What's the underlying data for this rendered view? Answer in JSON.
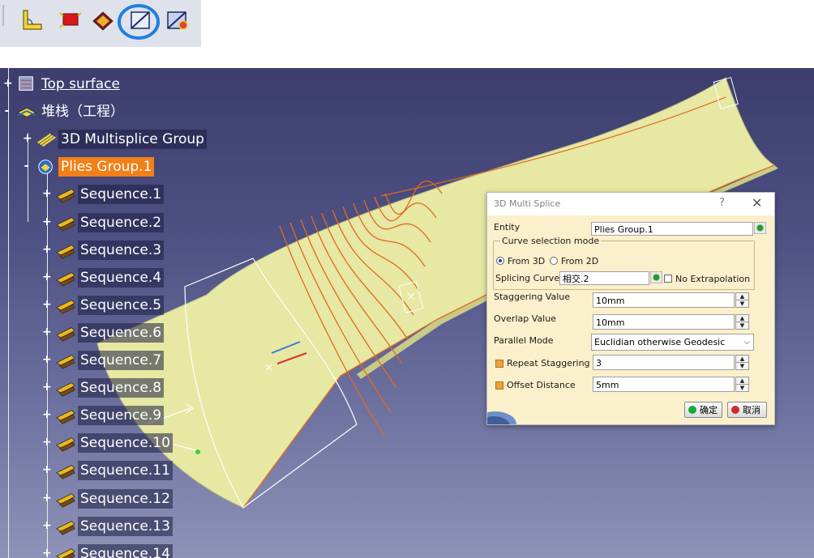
{
  "toolbar": {
    "icons": [
      "ply-angle-icon",
      "ply-rectangle-icon",
      "ply-exploder-icon",
      "multi-splice-icon",
      "splice-3d-icon"
    ],
    "highlighted_index": 3,
    "highlight_color": "#1e7fe0"
  },
  "tree": {
    "nodes": [
      {
        "label": "Top surface",
        "style": "underline",
        "icon": "surface-icon",
        "expander": "+"
      },
      {
        "label": "堆栈（工程）",
        "style": "plain",
        "icon": "stacking-icon",
        "expander": "-"
      },
      {
        "label": "3D Multisplice Group",
        "style": "dark",
        "icon": "multisplice-group-icon",
        "expander": "+"
      },
      {
        "label": "Plies Group.1",
        "style": "selected",
        "icon": "plies-group-icon",
        "expander": "-"
      },
      {
        "label": "Sequence.1",
        "style": "dark",
        "icon": "sequence-icon",
        "expander": "+"
      },
      {
        "label": "Sequence.2",
        "style": "dark",
        "icon": "sequence-icon",
        "expander": "+"
      },
      {
        "label": "Sequence.3",
        "style": "dark",
        "icon": "sequence-icon",
        "expander": "+"
      },
      {
        "label": "Sequence.4",
        "style": "dark",
        "icon": "sequence-icon",
        "expander": "+"
      },
      {
        "label": "Sequence.5",
        "style": "dark",
        "icon": "sequence-icon",
        "expander": "+"
      },
      {
        "label": "Sequence.6",
        "style": "dark",
        "icon": "sequence-icon",
        "expander": "+"
      },
      {
        "label": "Sequence.7",
        "style": "dark",
        "icon": "sequence-icon",
        "expander": "+"
      },
      {
        "label": "Sequence.8",
        "style": "dark",
        "icon": "sequence-icon",
        "expander": "+"
      },
      {
        "label": "Sequence.9",
        "style": "dark",
        "icon": "sequence-icon",
        "expander": "+"
      },
      {
        "label": "Sequence.10",
        "style": "dark",
        "icon": "sequence-icon",
        "expander": "+"
      },
      {
        "label": "Sequence.11",
        "style": "dark",
        "icon": "sequence-icon",
        "expander": "+"
      },
      {
        "label": "Sequence.12",
        "style": "dark",
        "icon": "sequence-icon",
        "expander": "+"
      },
      {
        "label": "Sequence.13",
        "style": "dark",
        "icon": "sequence-icon",
        "expander": "+"
      },
      {
        "label": "Sequence.14",
        "style": "dark",
        "icon": "sequence-icon",
        "expander": "+"
      }
    ]
  },
  "colors": {
    "selection": "#f28018",
    "surface": "#e6e8a4",
    "splice_lines": "#e26a1e",
    "dialog_bg": "#fbf0cc"
  },
  "dialog": {
    "title": "3D Multi Splice",
    "help": "?",
    "close": "✕",
    "entity_label": "Entity",
    "entity_value": "Plies Group.1",
    "curve_group_label": "Curve selection mode",
    "from3d_label": "From 3D",
    "from2d_label": "From 2D",
    "curve_mode_selected": "From 3D",
    "splicing_label": "Splicing Curves",
    "splicing_value": "相交.2",
    "no_extrap_label": "No Extrapolation",
    "no_extrap_checked": false,
    "stagger_label": "Staggering Value",
    "stagger_value": "10mm",
    "overlap_label": "Overlap Value",
    "overlap_value": "10mm",
    "parallel_label": "Parallel Mode",
    "parallel_value": "Euclidian otherwise Geodesic",
    "repeat_label": "Repeat Staggering",
    "repeat_value": "3",
    "offset_label": "Offset Distance",
    "offset_value": "5mm",
    "ok_label": "确定",
    "cancel_label": "取消"
  }
}
